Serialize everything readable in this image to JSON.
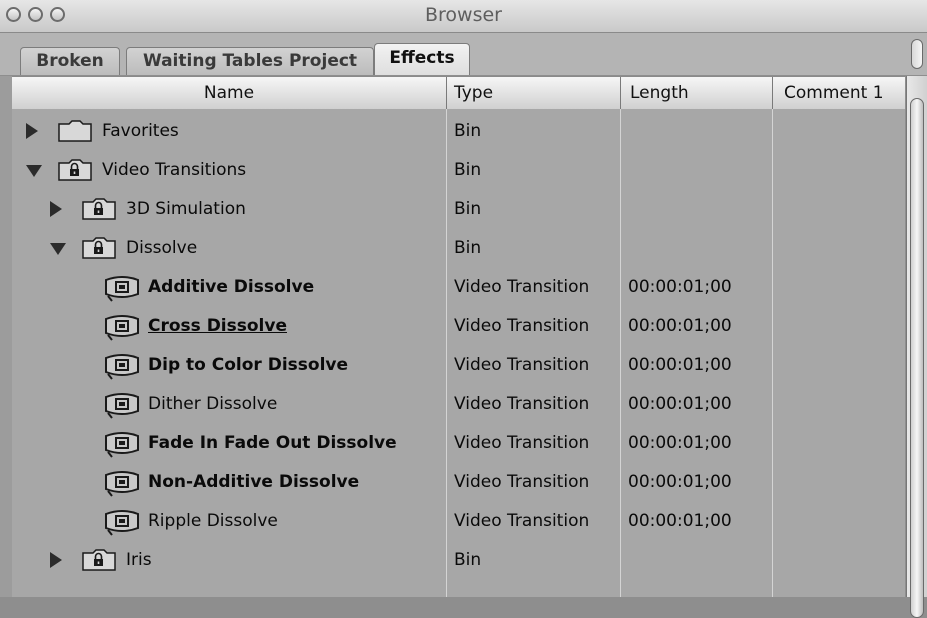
{
  "window": {
    "title": "Browser"
  },
  "tabs": [
    {
      "label": "Broken",
      "active": false
    },
    {
      "label": "Waiting Tables Project",
      "active": false
    },
    {
      "label": "Effects",
      "active": true
    }
  ],
  "columns": {
    "name": "Name",
    "type": "Type",
    "length": "Length",
    "comment": "Comment 1"
  },
  "rows": [
    {
      "name": "Favorites",
      "type": "Bin",
      "length": "",
      "kind": "folder",
      "locked": false,
      "disclosure": "closed",
      "indent": 0,
      "bold": false
    },
    {
      "name": "Video Transitions",
      "type": "Bin",
      "length": "",
      "kind": "folder",
      "locked": true,
      "disclosure": "open",
      "indent": 0,
      "bold": false
    },
    {
      "name": "3D Simulation",
      "type": "Bin",
      "length": "",
      "kind": "folder",
      "locked": true,
      "disclosure": "closed",
      "indent": 1,
      "bold": false
    },
    {
      "name": "Dissolve",
      "type": "Bin",
      "length": "",
      "kind": "folder",
      "locked": true,
      "disclosure": "open",
      "indent": 1,
      "bold": false
    },
    {
      "name": "Additive Dissolve",
      "type": "Video Transition",
      "length": "00:00:01;00",
      "kind": "effect",
      "bold": true
    },
    {
      "name": "Cross Dissolve",
      "type": "Video Transition",
      "length": "00:00:01;00",
      "kind": "effect",
      "bold": true,
      "underline": true
    },
    {
      "name": "Dip to Color Dissolve",
      "type": "Video Transition",
      "length": "00:00:01;00",
      "kind": "effect",
      "bold": true
    },
    {
      "name": "Dither Dissolve",
      "type": "Video Transition",
      "length": "00:00:01;00",
      "kind": "effect",
      "bold": false
    },
    {
      "name": "Fade In Fade Out Dissolve",
      "type": "Video Transition",
      "length": "00:00:01;00",
      "kind": "effect",
      "bold": true
    },
    {
      "name": "Non-Additive Dissolve",
      "type": "Video Transition",
      "length": "00:00:01;00",
      "kind": "effect",
      "bold": true
    },
    {
      "name": "Ripple Dissolve",
      "type": "Video Transition",
      "length": "00:00:01;00",
      "kind": "effect",
      "bold": false
    },
    {
      "name": "Iris",
      "type": "Bin",
      "length": "",
      "kind": "folder",
      "locked": true,
      "disclosure": "closed",
      "indent": 1,
      "bold": false
    }
  ]
}
